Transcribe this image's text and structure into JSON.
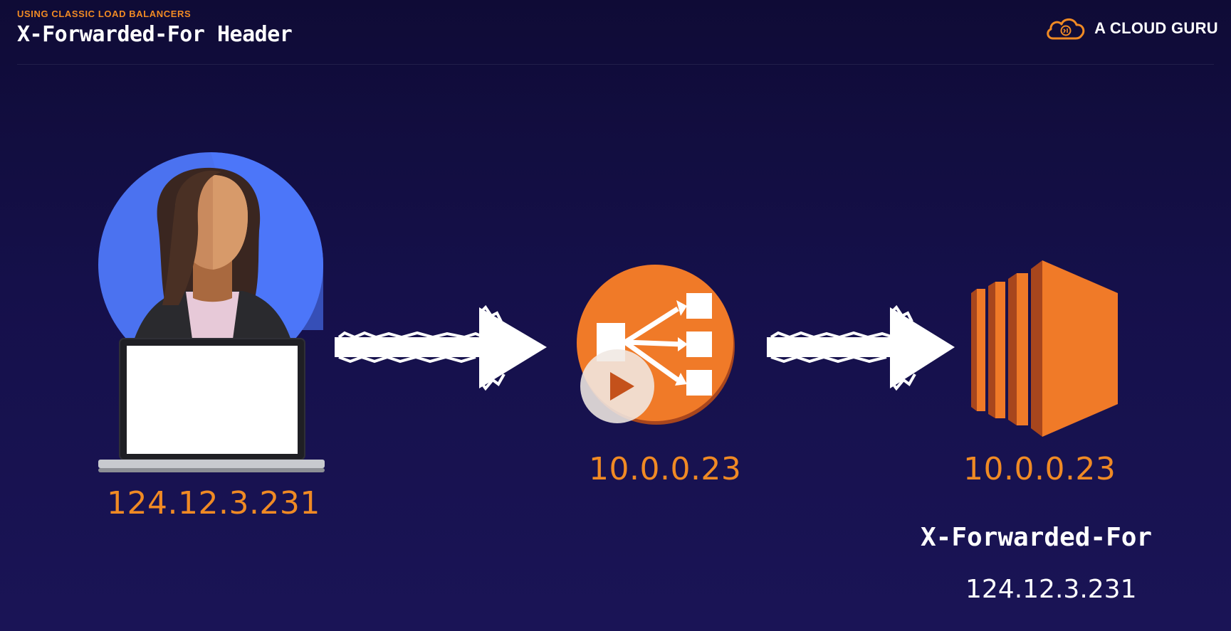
{
  "header": {
    "subtitle": "USING CLASSIC LOAD BALANCERS",
    "title": "X-Forwarded-For Header"
  },
  "brand": {
    "name": "A CLOUD GURU",
    "logo_icon": "cloud-logo-icon"
  },
  "diagram": {
    "client": {
      "icon": "user-with-laptop-icon",
      "ip": "124.12.3.231"
    },
    "arrow_1": {
      "icon": "arrow-right-icon"
    },
    "load_balancer": {
      "icon": "load-balancer-icon",
      "ip": "10.0.0.23"
    },
    "arrow_2": {
      "icon": "arrow-right-icon"
    },
    "ec2_instance": {
      "icon": "ec2-instance-icon",
      "ip": "10.0.0.23",
      "header_name": "X-Forwarded-For",
      "header_value": "124.12.3.231"
    }
  },
  "player": {
    "play_icon": "play-icon"
  },
  "colors": {
    "accent": "#f08a24",
    "background": "#15104a",
    "avatar_circle": "#4b72f0"
  }
}
